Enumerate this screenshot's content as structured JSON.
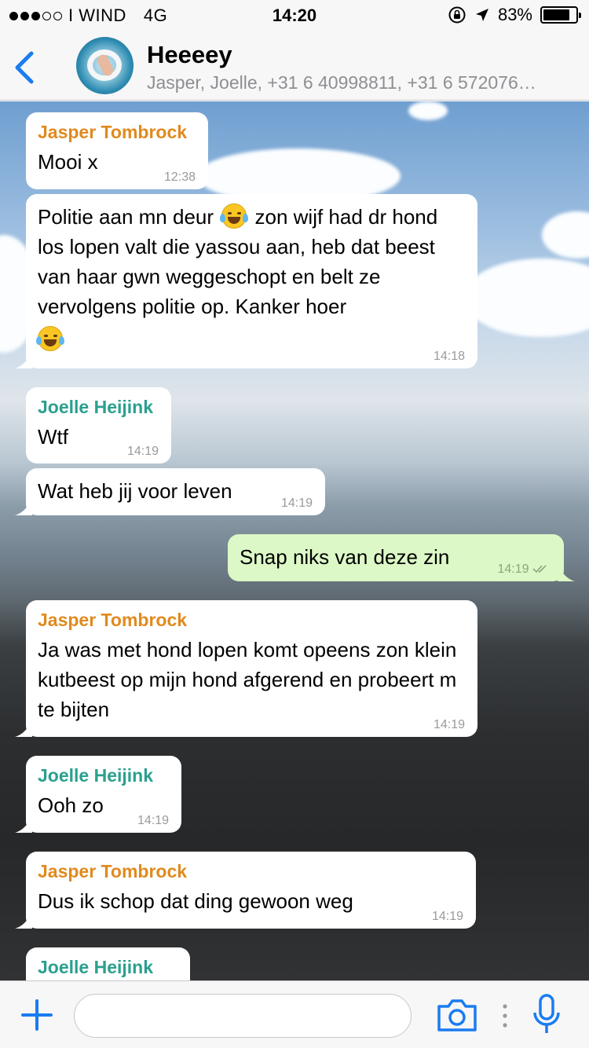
{
  "status_bar": {
    "carrier": "I WIND",
    "network": "4G",
    "time": "14:20",
    "battery_text": "83%",
    "battery_level": 0.83,
    "signal_filled": 3,
    "signal_total": 5
  },
  "header": {
    "title": "Heeeey",
    "subtitle": "Jasper, Joelle, +31 6 40998811, +31 6 572076…"
  },
  "colors": {
    "accent": "#1a7cf0",
    "outgoing_bubble": "#dcf8c6",
    "incoming_bubble": "#ffffff",
    "jasper_name": "#e08a1e",
    "joelle_name": "#2aa08f",
    "read_ticks": "#6fa8dc"
  },
  "messages": [
    {
      "sender": "Jasper Tombrock",
      "text": "Mooi x",
      "time": "12:38"
    },
    {
      "text_before_emoji": "Politie aan mn deur",
      "emoji": "face-with-tears-of-joy",
      "text_after_emoji": "zon wijf had dr hond los lopen valt die yassou aan, heb dat beest van haar gwn weggeschopt en belt ze vervolgens politie op. Kanker hoer",
      "time": "14:18"
    },
    {
      "sender": "Joelle Heijink",
      "text": "Wtf",
      "time": "14:19"
    },
    {
      "text": "Wat heb jij voor leven",
      "time": "14:19"
    },
    {
      "text": "Snap niks van deze zin",
      "time": "14:19",
      "status": "read"
    },
    {
      "sender": "Jasper Tombrock",
      "text": "Ja was met hond lopen komt opeens zon klein kutbeest op mijn hond afgerend en probeert m te bijten",
      "time": "14:19"
    },
    {
      "sender": "Joelle Heijink",
      "text": "Ooh zo",
      "time": "14:19"
    },
    {
      "sender": "Jasper Tombrock",
      "text": "Dus ik schop dat ding gewoon weg",
      "time": "14:19"
    },
    {
      "sender": "Joelle Heijink",
      "text": ""
    }
  ],
  "input": {
    "placeholder": "",
    "value": ""
  },
  "icons": {
    "back": "chevron-left-icon",
    "attach": "plus-icon",
    "camera": "camera-icon",
    "more": "more-dots-icon",
    "mic": "microphone-icon"
  }
}
